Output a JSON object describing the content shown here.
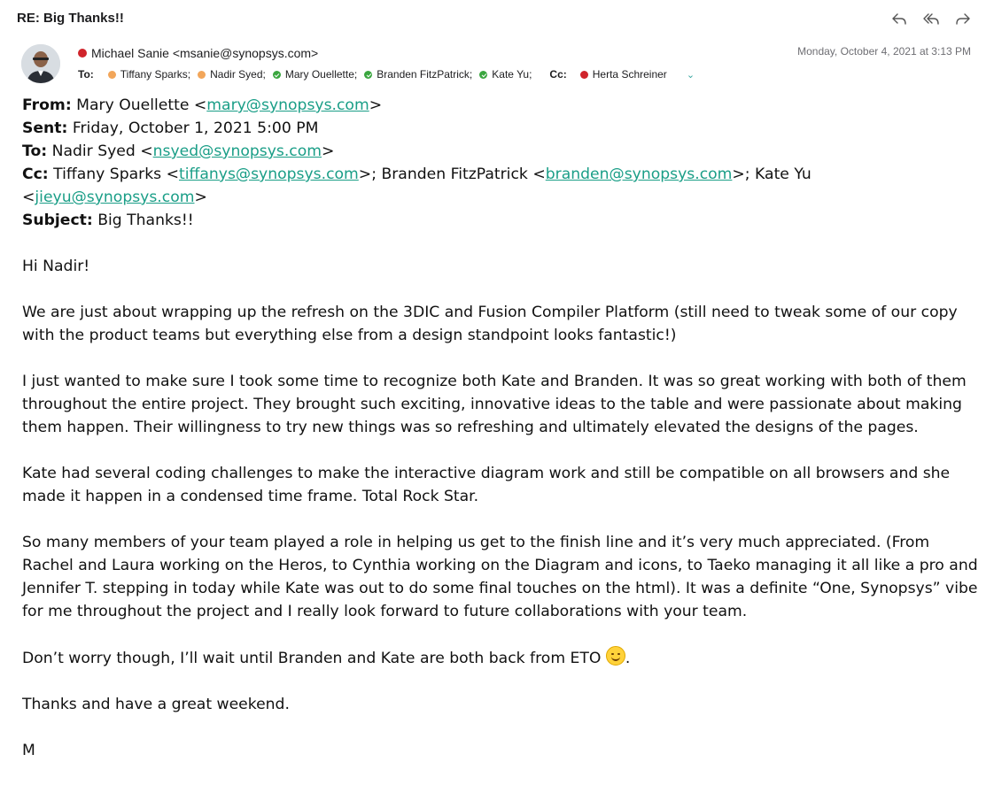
{
  "subject": "RE: Big Thanks!!",
  "toolbar": {
    "icons": [
      "reply-icon",
      "reply-all-icon",
      "forward-icon"
    ]
  },
  "sender": {
    "name_email": "Michael Sanie <msanie@synopsys.com>",
    "status_color": "#d0242b"
  },
  "date": "Monday, October 4, 2021 at 3:13 PM",
  "recipients": {
    "to_label": "To:",
    "to": [
      {
        "name": "Tiffany Sparks;",
        "status": "orange"
      },
      {
        "name": "Nadir Syed;",
        "status": "orange"
      },
      {
        "name": "Mary Ouellette;",
        "status": "green"
      },
      {
        "name": "Branden FitzPatrick;",
        "status": "green"
      },
      {
        "name": "Kate Yu;",
        "status": "green"
      }
    ],
    "cc_label": "Cc:",
    "cc": [
      {
        "name": "Herta Schreiner",
        "status": "red"
      }
    ]
  },
  "quoted_header": {
    "from_label": "From:",
    "from_name": " Mary Ouellette <",
    "from_email": "mary@synopsys.com",
    "sent_label": "Sent:",
    "sent_value": " Friday, October 1, 2021 5:00 PM",
    "to_label": "To:",
    "to_name": " Nadir Syed <",
    "to_email": "nsyed@synopsys.com",
    "cc_label": "Cc:",
    "cc_1_name": " Tiffany Sparks <",
    "cc_1_email": "tiffanys@synopsys.com",
    "cc_2_name": ">; Branden FitzPatrick <",
    "cc_2_email": "branden@synopsys.com",
    "cc_3_name": ">; Kate Yu <",
    "cc_3_email": "jieyu@synopsys.com",
    "subject_label": "Subject:",
    "subject_value": " Big Thanks!!"
  },
  "body": {
    "greeting": "Hi Nadir!",
    "p1": "We are just about wrapping up the refresh on the 3DIC and Fusion Compiler Platform (still need to tweak some of our copy with the product teams but everything else from a design standpoint looks fantastic!)",
    "p2": "I just wanted to make sure I took some time to recognize both Kate and Branden. It was so great working with both of them throughout the entire project. They brought such exciting, innovative ideas to the table and were passionate about making them happen. Their willingness to try new things was so refreshing and ultimately elevated the designs of the pages.",
    "p3": "Kate had several coding challenges to make the interactive diagram work and still be compatible on all browsers and she made it happen in a condensed time frame. Total Rock Star.",
    "p4": "So many members of your team played a role in helping us get to the finish line and it’s very much appreciated. (From Rachel and Laura working on the Heros, to Cynthia working on the Diagram and icons, to Taeko managing it all like a pro and Jennifer T. stepping in today while Kate was out to do some final touches on the html). It was a definite “One, Synopsys” vibe for me throughout the project and I really look forward to future collaborations with your team.",
    "p5": "Don’t worry though, I’ll wait until Branden and Kate are both back from ETO ",
    "p5_end": ".",
    "p6": "Thanks and have a great weekend.",
    "signoff": "M"
  }
}
